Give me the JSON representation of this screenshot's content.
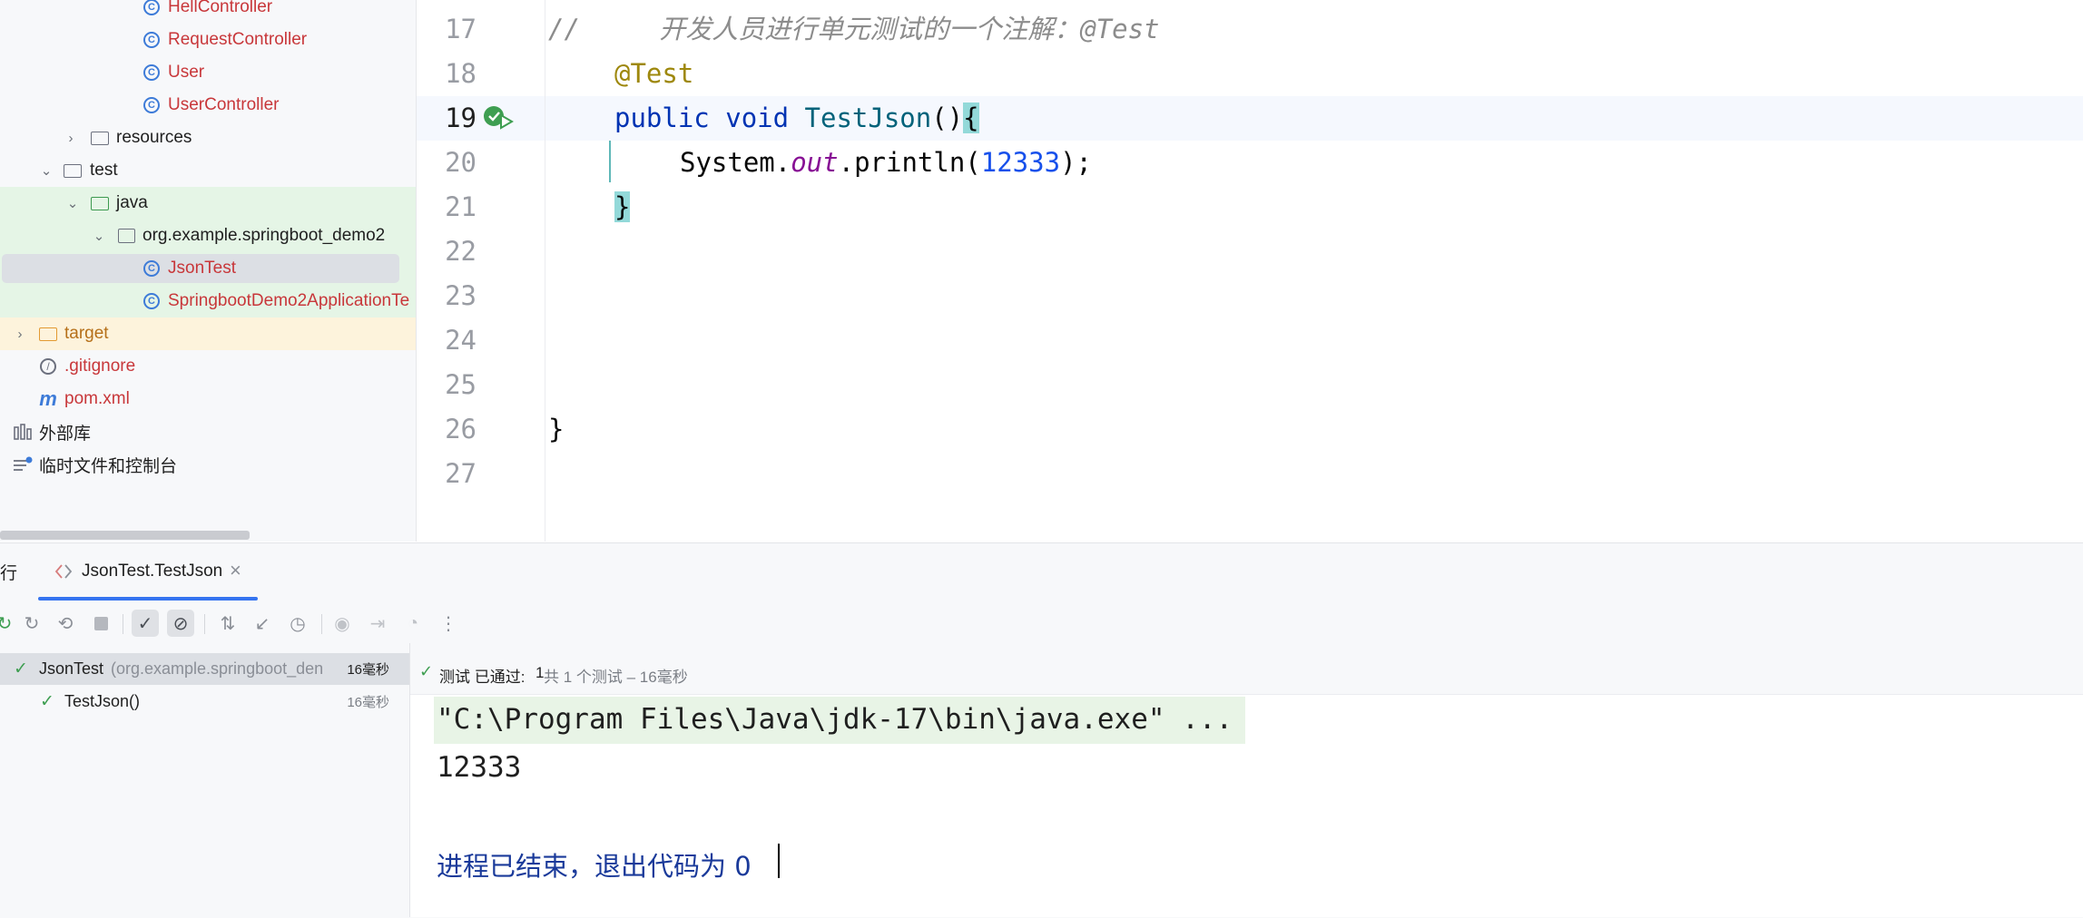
{
  "project_tree": {
    "items": [
      {
        "label": "HellController",
        "kind": "class"
      },
      {
        "label": "RequestController",
        "kind": "class"
      },
      {
        "label": "User",
        "kind": "class"
      },
      {
        "label": "UserController",
        "kind": "class"
      },
      {
        "label": "resources",
        "kind": "folder"
      },
      {
        "label": "test",
        "kind": "folder"
      },
      {
        "label": "java",
        "kind": "folder"
      },
      {
        "label": "org.example.springboot_demo2",
        "kind": "package"
      },
      {
        "label": "JsonTest",
        "kind": "test-class"
      },
      {
        "label": "SpringbootDemo2ApplicationTe",
        "kind": "test-class"
      },
      {
        "label": "target",
        "kind": "folder"
      },
      {
        "label": ".gitignore",
        "kind": "file"
      },
      {
        "label": "pom.xml",
        "kind": "maven"
      },
      {
        "label": "外部库",
        "kind": "library"
      },
      {
        "label": "临时文件和控制台",
        "kind": "scratch"
      }
    ]
  },
  "editor": {
    "line_numbers": [
      "17",
      "18",
      "19",
      "20",
      "21",
      "22",
      "23",
      "24",
      "25",
      "26",
      "27"
    ],
    "lines": {
      "l17_comment": "//     开发人员进行单元测试的一个注解：@Test",
      "l18_annotation": "@Test",
      "l19_kw1": "public",
      "l19_kw2": "void",
      "l19_fn": "TestJson",
      "l19_paren": "()",
      "l19_brace": "{",
      "l20_sys": "System.",
      "l20_out": "out",
      "l20_call": ".println(",
      "l20_num": "12333",
      "l20_end": ");",
      "l21_brace": "}",
      "l26_brace": "}"
    }
  },
  "run_panel": {
    "title": "行",
    "tab_label": "JsonTest.TestJson",
    "tab_close": "×",
    "test_tree": [
      {
        "name": "JsonTest",
        "detail": " (org.example.springboot_den",
        "time": "16毫秒"
      },
      {
        "name": "TestJson()",
        "detail": "",
        "time": "16毫秒"
      }
    ],
    "status": {
      "prefix": "测试 已通过: ",
      "count": "1",
      "suffix": "共 1 个测试 – 16毫秒"
    },
    "console": {
      "cmd": "\"C:\\Program Files\\Java\\jdk-17\\bin\\java.exe\" ...",
      "output": "12333",
      "exit": "进程已结束，退出代码为 0"
    }
  },
  "colors": {
    "accent": "#3574f0",
    "pass_green": "#3e9e51",
    "error_red": "#c8373a"
  },
  "toolbar_icons": [
    "rerun-icon",
    "rerun-failed-icon",
    "toggle-auto-test-icon",
    "stop-icon",
    "show-passed-icon",
    "show-ignored-icon",
    "sort-icon",
    "collapse-icon",
    "history-icon",
    "screenshot-icon",
    "export-icon",
    "coverage-icon",
    "more-icon"
  ]
}
